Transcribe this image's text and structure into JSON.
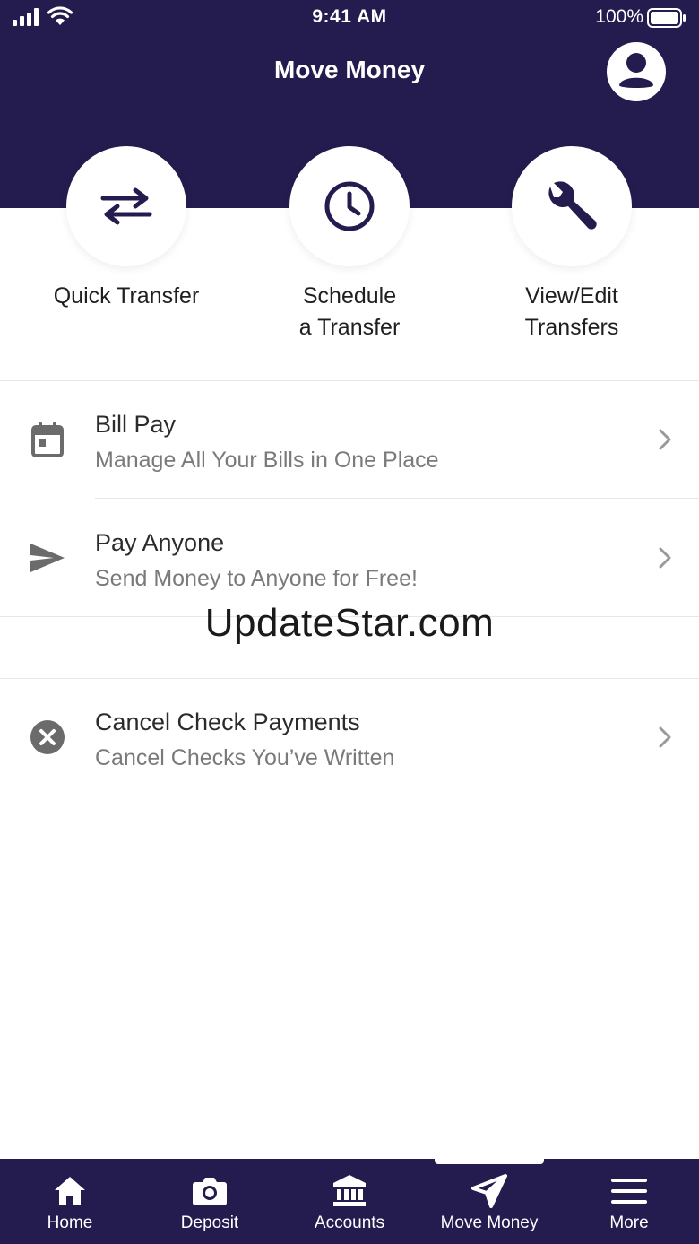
{
  "status_bar": {
    "time": "9:41 AM",
    "battery": "100%"
  },
  "header": {
    "title": "Move Money"
  },
  "actions": [
    {
      "label": "Quick Transfer",
      "icon": "swap-arrows-icon"
    },
    {
      "label": "Schedule\na Transfer",
      "icon": "clock-icon"
    },
    {
      "label": "View/Edit\nTransfers",
      "icon": "wrench-icon"
    }
  ],
  "list": [
    {
      "title": "Bill Pay",
      "subtitle": "Manage All Your Bills in One Place",
      "icon": "calendar-icon"
    },
    {
      "title": "Pay Anyone",
      "subtitle": "Send Money to Anyone for Free!",
      "icon": "send-icon"
    },
    {
      "title": "Cancel Check Payments",
      "subtitle": "Cancel Checks You’ve Written",
      "icon": "cancel-circle-icon"
    }
  ],
  "watermark": "UpdateStar.com",
  "tabbar": {
    "active_index": 3,
    "tabs": [
      {
        "label": "Home",
        "icon": "home-icon"
      },
      {
        "label": "Deposit",
        "icon": "camera-icon"
      },
      {
        "label": "Accounts",
        "icon": "bank-icon"
      },
      {
        "label": "Move Money",
        "icon": "send-icon"
      },
      {
        "label": "More",
        "icon": "menu-icon"
      }
    ]
  },
  "colors": {
    "brand": "#241c4e",
    "icon_gray": "#6b6b6b",
    "subtitle_gray": "#7a7a7a"
  }
}
